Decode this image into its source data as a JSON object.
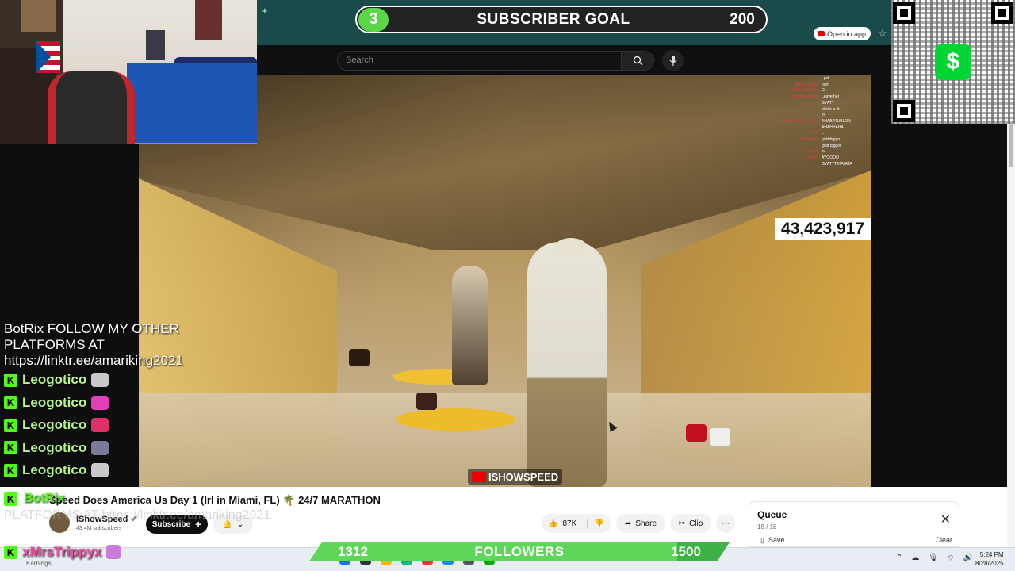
{
  "subscriber_goal": {
    "current": "3",
    "label": "SUBSCRIBER GOAL",
    "target": "200"
  },
  "browser": {
    "open_in_app": "Open in app"
  },
  "youtube": {
    "search_placeholder": "Search",
    "video_title": "Speed Does America Us Day 1 (Irl in Miami, FL) 🌴 24/7 MARATHON",
    "channel_name": "IShowSpeed",
    "channel_subs": "43.4M subscribers",
    "subscribe_label": "Subscribe",
    "likes": "87K",
    "share_label": "Share",
    "clip_label": "Clip",
    "queue": {
      "title": "Queue",
      "count": "18 / 18",
      "save": "Save",
      "clear": "Clear"
    }
  },
  "video": {
    "viewer_count": "43,423,917",
    "watermark": "ISHOWSPEED",
    "mini_chat": [
      {
        "user": "",
        "text": "Lpst"
      },
      {
        "user": "Saved Nation",
        "text": "bart"
      },
      {
        "user": "Winter Sanders",
        "text": "O"
      },
      {
        "user": "Enrique Marin",
        "text": "Leave her"
      },
      {
        "user": "",
        "text": "GYATT"
      },
      {
        "user": "",
        "text": "skoke a fit"
      },
      {
        "user": "",
        "text": "lol"
      },
      {
        "user": "Andres Felipe Cerpa",
        "text": "AHABATUBLON"
      },
      {
        "user": "",
        "text": "AHAHHAHA"
      },
      {
        "user": "Bob",
        "text": "L"
      },
      {
        "user": "Luis pillow",
        "text": "golddigger"
      },
      {
        "user": "",
        "text": "gold digger"
      },
      {
        "user": "Kaiser",
        "text": "cv"
      },
      {
        "user": "Pibbly",
        "text": "AYOOOO"
      },
      {
        "user": "",
        "text": "GYATTTATATATA"
      }
    ]
  },
  "chat": {
    "bot_message": "BotRix FOLLOW MY OTHER PLATFORMS AT https://linktr.ee/amariking2021",
    "messages": [
      {
        "name": "Leogotico",
        "emote_color": "#c9c9c9"
      },
      {
        "name": "Leogotico",
        "emote_color": "#e23fb8"
      },
      {
        "name": "Leogotico",
        "emote_color": "#e0306a"
      },
      {
        "name": "Leogotico",
        "emote_color": "#7a7a9a"
      },
      {
        "name": "Leogotico",
        "emote_color": "#c9c9c9"
      }
    ],
    "bot_name_2": "BotRix",
    "ghost_text": "PLATFORMS AT https://linktr.ee/amariking2021",
    "last_user": "xMrsTrippyx"
  },
  "followers": {
    "current": "1312",
    "label": "FOLLOWERS",
    "target": "1500",
    "progress": 0.875
  },
  "taskbar": {
    "earnings_label": "Earnings",
    "time": "5:24 PM",
    "date": "8/28/2025"
  },
  "colors": {
    "kick_green": "#53fc18",
    "goal_green": "#5bd64b",
    "cashapp_green": "#00d632",
    "teal_bar": "#1b4a4a"
  }
}
